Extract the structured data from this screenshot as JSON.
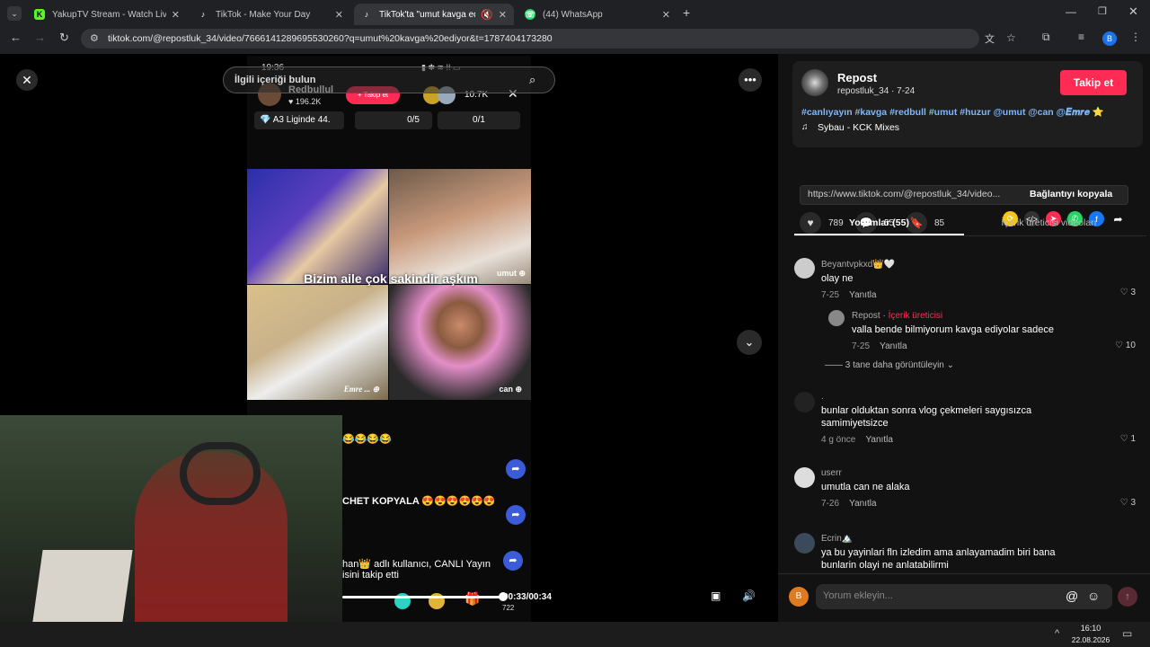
{
  "browser": {
    "tabs": [
      {
        "label": "YakupTV Stream - Watch Live o",
        "icon": "K"
      },
      {
        "label": "TikTok - Make Your Day",
        "icon": "♪"
      },
      {
        "label": "TikTok'ta \"umut kavga ediyo",
        "icon": "♪"
      },
      {
        "label": "(44) WhatsApp",
        "icon": "☏"
      }
    ],
    "url": "tiktok.com/@repostluk_34/video/7666141289695530260?q=umut%20kavga%20ediyor&t=1787404173280",
    "profile_initial": "B"
  },
  "player": {
    "search_placeholder": "İlgili içeriği bulun",
    "time": "00:33/00:34"
  },
  "live": {
    "status_time": "19:36",
    "host_name": "Redbullul",
    "host_likes": "196.2K",
    "follow_label": "Takip et",
    "viewers": "10.7K",
    "league": "A3 Liginde 44.",
    "score_a": "0/5",
    "score_b": "0/1",
    "caption": "Bizim aile çok sakindir aşkım",
    "cell_tags": [
      "umut",
      "Emre ...",
      "can"
    ],
    "chat": [
      "😂😂😂😂",
      "CHET KOPYALA 😍😍😍😍😍😍",
      "han👑 adlı kullanıcı, CANLI Yayın",
      "isini takip etti"
    ],
    "gift_count": "722"
  },
  "post": {
    "author": "Repost",
    "handle_date": "repostluk_34 · 7-24",
    "follow_label": "Takip et",
    "hashtags": "#canlıyayın #kavga #redbull #umut #huzur @umut @can @𝑬𝒎𝒓𝒆 ⭐",
    "music": "Sybau - KCK Mixes",
    "likes": "789",
    "comments": "55",
    "saves": "85",
    "link": "https://www.tiktok.com/@repostluk_34/video...",
    "copy_label": "Bağlantıyı kopyala",
    "tab_comments": "Yorumlar (55)",
    "tab_creator": "İçerik üreticisi videoları"
  },
  "comments": [
    {
      "name": "Beyantvpkxd👑🤍",
      "text": "olay ne",
      "date": "7-25",
      "reply": "Yanıtla",
      "likes": "3"
    },
    {
      "name": "Repost · İçerik üreticisi",
      "text": "valla bende bilmiyorum kavga ediyolar sadece",
      "date": "7-25",
      "reply": "Yanıtla",
      "likes": "10"
    },
    {
      "name": ".",
      "text": "bunlar olduktan sonra vlog çekmeleri saygısızca samimiyetsizce",
      "date": "4 g önce",
      "reply": "Yanıtla",
      "likes": "1"
    },
    {
      "name": "userr",
      "text": "umutla can ne alaka",
      "date": "7-26",
      "reply": "Yanıtla",
      "likes": "3"
    },
    {
      "name": "Ecrin🏔️",
      "text": "ya bu yayinlari fln izledim ama anlayamadim biri bana bunlarin olayi ne anlatabilirmi",
      "date": "",
      "reply": "",
      "likes": ""
    }
  ],
  "more_replies": "3 tane daha görüntüleyin",
  "comment_input_placeholder": "Yorum ekleyin...",
  "taskbar": {
    "time": "16:10",
    "date": "22.08.2026"
  },
  "colors": {
    "tiktok_red": "#fe2c55",
    "bg": "#121212"
  }
}
